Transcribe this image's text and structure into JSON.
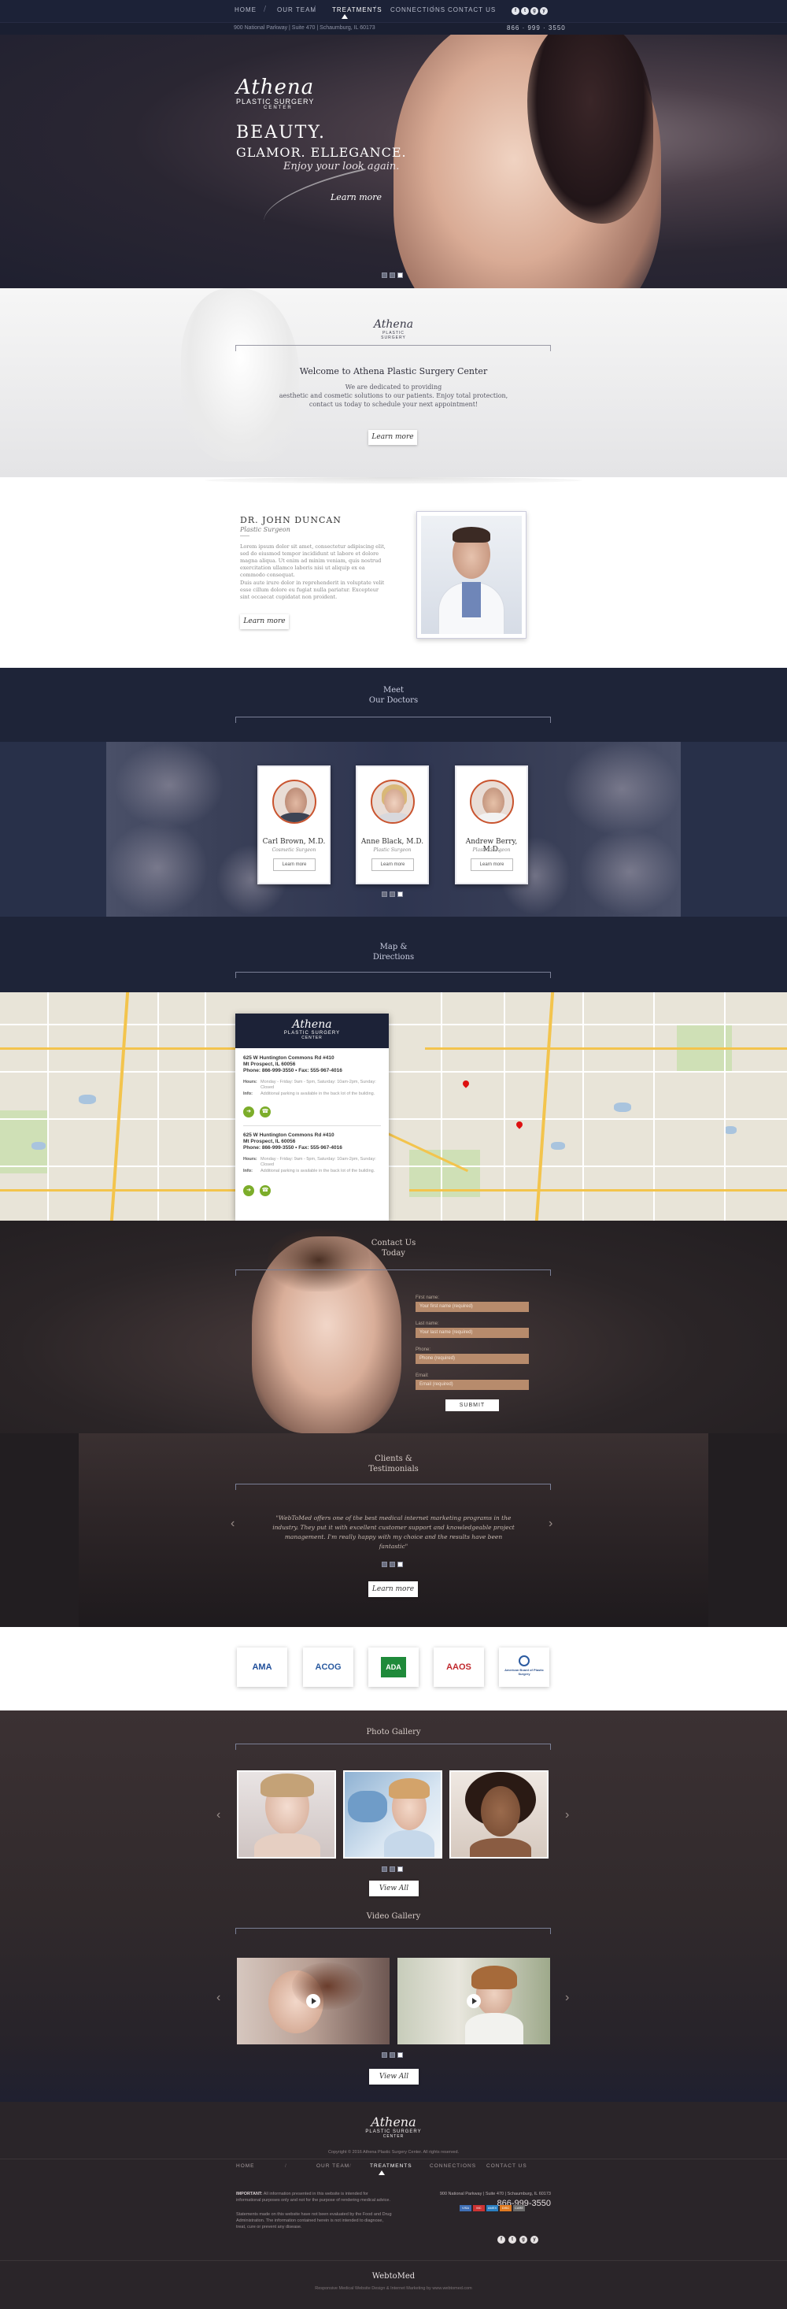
{
  "nav": {
    "items": [
      "HOME",
      "OUR TEAM",
      "TREATMENTS",
      "CONNECTIONS",
      "CONTACT US"
    ],
    "active": "TREATMENTS"
  },
  "infobar": {
    "address": "900 National Parkway | Suite 470 | Schaumburg, IL 60173",
    "phone": "866 · 999 · 3550",
    "social": [
      "f",
      "t",
      "g",
      "y"
    ]
  },
  "hero": {
    "logo_line1": "Athena",
    "logo_line2": "PLASTIC SURGERY",
    "logo_line3": "CENTER",
    "headline1": "BEAUTY.",
    "headline2": "GLAMOR. ELLEGANCE.",
    "tagline": "Enjoy your look again.",
    "cta": "Learn more"
  },
  "welcome": {
    "title": "Welcome to Athena Plastic Surgery Center",
    "text_lines": [
      "We are dedicated to providing",
      "aesthetic and cosmetic solutions to our patients.  Enjoy total protection,",
      "contact us today to schedule your next appointment!"
    ],
    "cta": "Learn more"
  },
  "doctor": {
    "name": "DR. JOHN DUNCAN",
    "title": "Plastic Surgeon",
    "para1": "Lorem ipsum dolor sit amet, consectetur adipiscing elit, sed do eiusmod tempor incididunt ut labore et dolore magna aliqua. Ut enim ad minim veniam, quis nostrud exercitation ullamco laboris nisi ut aliquip ex ea commodo consequat.",
    "para2": "Duis aute irure dolor in reprehenderit in voluptate velit esse cillum dolore eu fugiat nulla pariatur. Excepteur sint occaecat cupidatat non proident.",
    "cta": "Learn more"
  },
  "meet": {
    "title_line1": "Meet",
    "title_line2": "Our Doctors",
    "doctors": [
      {
        "name": "Carl Brown, M.D.",
        "role": "Cosmetic Surgeon",
        "cta": "Learn more"
      },
      {
        "name": "Anne Black, M.D.",
        "role": "Plastic Surgeon",
        "cta": "Learn more"
      },
      {
        "name": "Andrew Berry, M.D.",
        "role": "Plastic Surgeon",
        "cta": "Learn more"
      }
    ]
  },
  "map": {
    "title_line1": "Map &",
    "title_line2": "Directions",
    "locations": [
      {
        "addr1": "625 W Huntington Commons Rd #410",
        "addr2": "Mt Prospect, IL 60056",
        "phone": "Phone: 866-999-3550  •  Fax: 555-967-4016",
        "hours_label": "Hours:",
        "hours": "Monday - Friday: 9am - 5pm, Saturday: 10am-2pm, Sunday: Closed",
        "info_label": "Info:",
        "info": "Additional parking is available in the back lot of the building."
      },
      {
        "addr1": "625 W Huntington Commons Rd #410",
        "addr2": "Mt Prospect, IL 60056",
        "phone": "Phone: 866-999-3550  •  Fax: 555-967-4016",
        "hours_label": "Hours:",
        "hours": "Monday - Friday: 9am - 5pm, Saturday: 10am-2pm, Sunday: Closed",
        "info_label": "Info:",
        "info": "Additional parking is available in the back lot of the building."
      }
    ]
  },
  "contact": {
    "title_line1": "Contact Us",
    "title_line2": "Today",
    "fields": [
      {
        "label": "First name:",
        "placeholder": "Your first name (required)"
      },
      {
        "label": "Last name:",
        "placeholder": "Your last name (required)"
      },
      {
        "label": "Phone:",
        "placeholder": "Phone (required)"
      },
      {
        "label": "Email:",
        "placeholder": "Email (required)"
      }
    ],
    "submit": "SUBMIT"
  },
  "testimonials": {
    "title_line1": "Clients &",
    "title_line2": "Testimonials",
    "quote": "\"WebToMed offers one of the best medical internet marketing programs in the industry. They put it with excellent customer support and knowledgeable project management. I'm really happy with my choice and the results have been fantastic\"",
    "cta": "Learn more"
  },
  "logos": [
    "AMA",
    "ACOG",
    "ADA",
    "AAOS",
    "American Board of Plastic Surgery"
  ],
  "gallery": {
    "photo_title": "Photo Gallery",
    "photo_cta": "View All",
    "video_title": "Video Gallery",
    "video_cta": "View All"
  },
  "footer": {
    "logo_line1": "Athena",
    "logo_line2": "PLASTIC SURGERY",
    "logo_line3": "CENTER",
    "copyright": "Copyright © 2016 Athena Plastic Surgery Center. All rights reserved.",
    "nav": [
      "HOME",
      "OUR TEAM",
      "TREATMENTS",
      "CONNECTIONS",
      "CONTACT US"
    ],
    "important_label": "IMPORTANT:",
    "important": "All information presented in this website is intended for informational purposes only and not for the purpose of rendering medical advice.",
    "disclaimer": "Statements made on this website have not been evaluated by the Food and Drug Administration. The information contained herein is not intended to diagnose, treat, cure or prevent any disease.",
    "address": "900 National Parkway  |  Suite 470  |  Schaumburg, IL 60173",
    "phone": "866-999-3550",
    "badges": [
      "VISA",
      "MC",
      "AMEX",
      "DISC",
      "CARE"
    ],
    "social": [
      "f",
      "t",
      "g",
      "y"
    ],
    "credit_logo": "WebtoMed",
    "credit": "Responsive Medical Website Design & Internet Marketing by www.webtomed.com"
  }
}
